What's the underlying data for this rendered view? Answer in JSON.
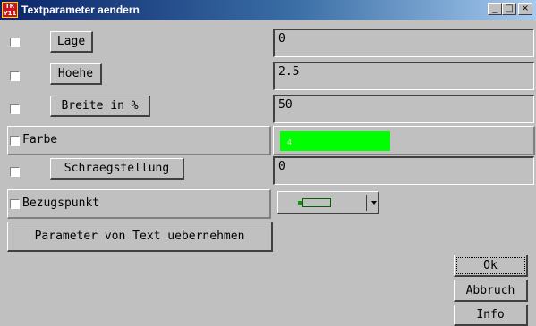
{
  "window": {
    "title": "Textparameter aendern",
    "icon_text_top": "TR",
    "icon_text_bottom": "Y11",
    "min_glyph": "_",
    "max_glyph": "□",
    "close_glyph": "×"
  },
  "fields": {
    "lage": {
      "label": "Lage",
      "value": "0"
    },
    "hoehe": {
      "label": "Hoehe",
      "value": "2.5"
    },
    "breite": {
      "label": "Breite in %",
      "value": "50"
    },
    "farbe": {
      "label": "Farbe",
      "value": "4",
      "color": "#00ff00"
    },
    "schraeg": {
      "label": "Schraegstellung",
      "value": "0"
    },
    "bezug": {
      "label": "Bezugspunkt"
    }
  },
  "buttons": {
    "uebernehmen": "Parameter von Text uebernehmen",
    "ok": "Ok",
    "abbruch": "Abbruch",
    "info": "Info"
  }
}
